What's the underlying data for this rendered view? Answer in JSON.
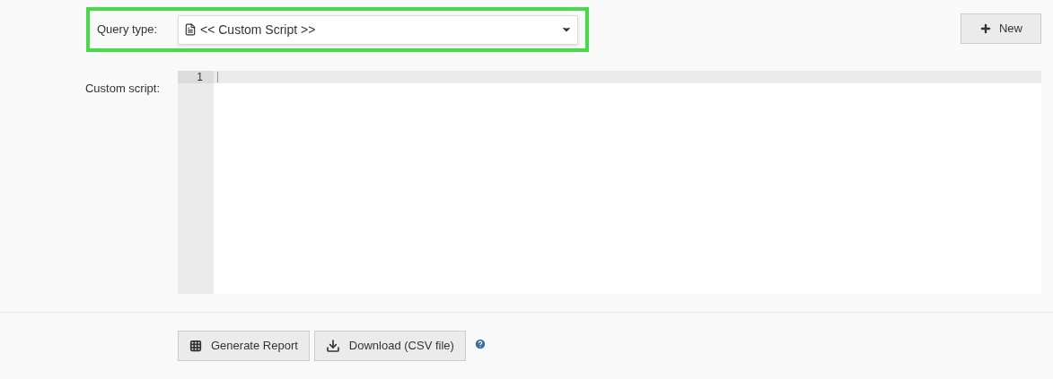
{
  "query_type": {
    "label": "Query type:",
    "value": "<< Custom Script >>"
  },
  "new_button": {
    "label": "New"
  },
  "custom_script": {
    "label": "Custom script:",
    "line_numbers": [
      "1"
    ]
  },
  "actions": [
    {
      "kind": "grid",
      "label": "Generate Report"
    },
    {
      "kind": "download",
      "label": "Download (CSV file)"
    }
  ]
}
